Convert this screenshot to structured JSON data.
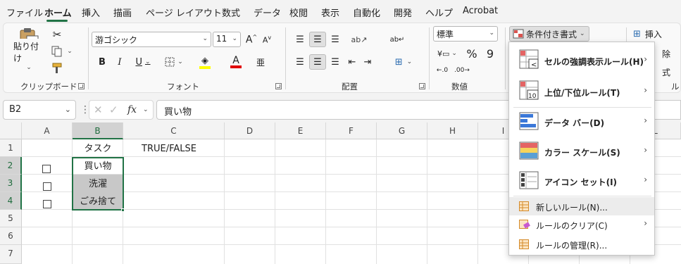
{
  "menu_tabs": [
    "ファイル",
    "ホーム",
    "挿入",
    "描画",
    "ページ レイアウト",
    "数式",
    "データ",
    "校閲",
    "表示",
    "自動化",
    "開発",
    "ヘルプ",
    "Acrobat"
  ],
  "ribbon": {
    "clipboard": {
      "paste_label": "貼り付け",
      "group_label": "クリップボード"
    },
    "font": {
      "font_name": "游ゴシック",
      "font_size": "11",
      "group_label": "フォント"
    },
    "alignment": {
      "group_label": "配置"
    },
    "number": {
      "format": "標準",
      "percent": "%",
      "comma": "9",
      "group_label": "数値"
    },
    "styles": {
      "conditional_format": "条件付き書式"
    },
    "cells": {
      "insert": "挿入",
      "delete": "除",
      "format": "式",
      "group_label": "ル"
    }
  },
  "formula_bar": {
    "name_box": "B2",
    "fx": "fx",
    "content": "買い物"
  },
  "grid": {
    "columns": [
      "A",
      "B",
      "C",
      "D",
      "E",
      "F",
      "G",
      "H",
      "I",
      "L"
    ],
    "rows": [
      "1",
      "2",
      "3",
      "4",
      "5",
      "6",
      "7"
    ],
    "cells": {
      "B1": "タスク",
      "C1": "TRUE/FALSE",
      "B2": "買い物",
      "B3": "洗濯",
      "B4": "ごみ捨て"
    }
  },
  "conditional_menu": {
    "items": [
      "セルの強調表示ルール(H)",
      "上位/下位ルール(T)",
      "データ バー(D)",
      "カラー スケール(S)",
      "アイコン セット(I)",
      "新しいルール(N)...",
      "ルールのクリア(C)",
      "ルールの管理(R)..."
    ]
  },
  "colors": {
    "accent": "#217346",
    "selected_cell_fill": "#c8c8c8"
  }
}
